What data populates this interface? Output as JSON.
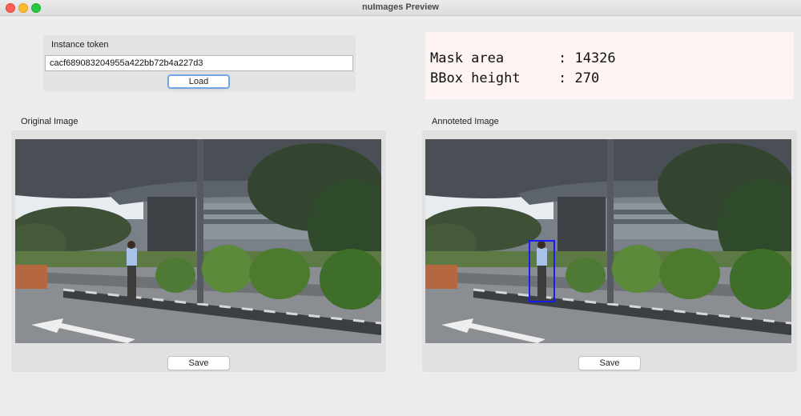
{
  "window": {
    "title": "nuImages Preview"
  },
  "token": {
    "label": "Instance token",
    "value": "cacf689083204955a422bb72b4a227d3",
    "load_label": "Load"
  },
  "info": {
    "mask_area_label": "Mask area",
    "mask_area_value": ": 14326",
    "bbox_height_label": "BBox height",
    "bbox_height_value": ": 270"
  },
  "original": {
    "label": "Original Image",
    "save_label": "Save"
  },
  "annotated": {
    "label": "Annoteted Image",
    "save_label": "Save",
    "bbox_color": "#1a1aff"
  }
}
